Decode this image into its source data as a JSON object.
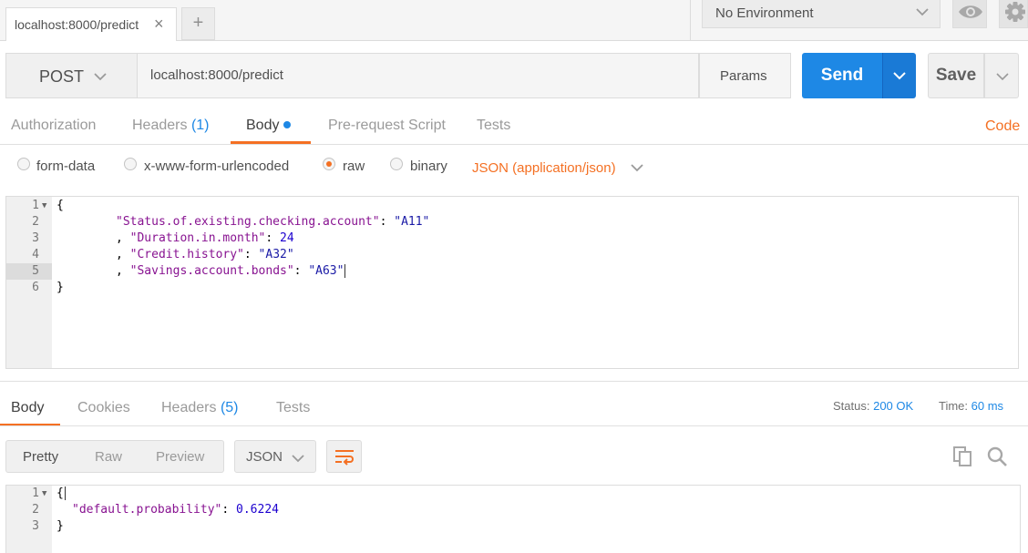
{
  "tab": {
    "title": "localhost:8000/predict",
    "close": "×",
    "new": "+"
  },
  "environment": {
    "selected": "No Environment"
  },
  "request": {
    "method": "POST",
    "url": "localhost:8000/predict",
    "params_label": "Params",
    "send_label": "Send",
    "save_label": "Save"
  },
  "request_tabs": {
    "authorization": "Authorization",
    "headers": "Headers",
    "headers_count": "(1)",
    "body": "Body",
    "prerequest": "Pre-request Script",
    "tests": "Tests",
    "code": "Code"
  },
  "body_types": {
    "form_data": "form-data",
    "urlencoded": "x-www-form-urlencoded",
    "raw": "raw",
    "binary": "binary",
    "content_type": "JSON (application/json)"
  },
  "request_body": {
    "line_numbers": [
      "1",
      "2",
      "3",
      "4",
      "5",
      "6"
    ],
    "l1": "{",
    "l2_key": "\"Status.of.existing.checking.account\"",
    "l2_val": "\"A11\"",
    "l3_key": "\"Duration.in.month\"",
    "l3_val": "24",
    "l4_key": "\"Credit.history\"",
    "l4_val": "\"A32\"",
    "l5_key": "\"Savings.account.bonds\"",
    "l5_val": "\"A63\"",
    "l6": "}",
    "colon": ": ",
    "comma": ", "
  },
  "response_tabs": {
    "body": "Body",
    "cookies": "Cookies",
    "headers": "Headers",
    "headers_count": "(5)",
    "tests": "Tests"
  },
  "response_status": {
    "status_label": "Status:",
    "status_value": "200 OK",
    "time_label": "Time:",
    "time_value": "60 ms"
  },
  "response_view": {
    "pretty": "Pretty",
    "raw": "Raw",
    "preview": "Preview",
    "format": "JSON"
  },
  "response_body": {
    "line_numbers": [
      "1",
      "2",
      "3"
    ],
    "l1": "{",
    "l2_key": "\"default.probability\"",
    "l2_val": "0.6224",
    "l3": "}",
    "colon": ": "
  },
  "colors": {
    "accent_orange": "#f47023",
    "send_blue": "#1e88e5"
  },
  "icons": {
    "env_dropdown": "chevron-down-icon",
    "eye": "eye-icon",
    "settings": "gear-icon",
    "wrap": "wrap-lines-icon",
    "copy": "copy-icon",
    "search": "search-icon"
  }
}
